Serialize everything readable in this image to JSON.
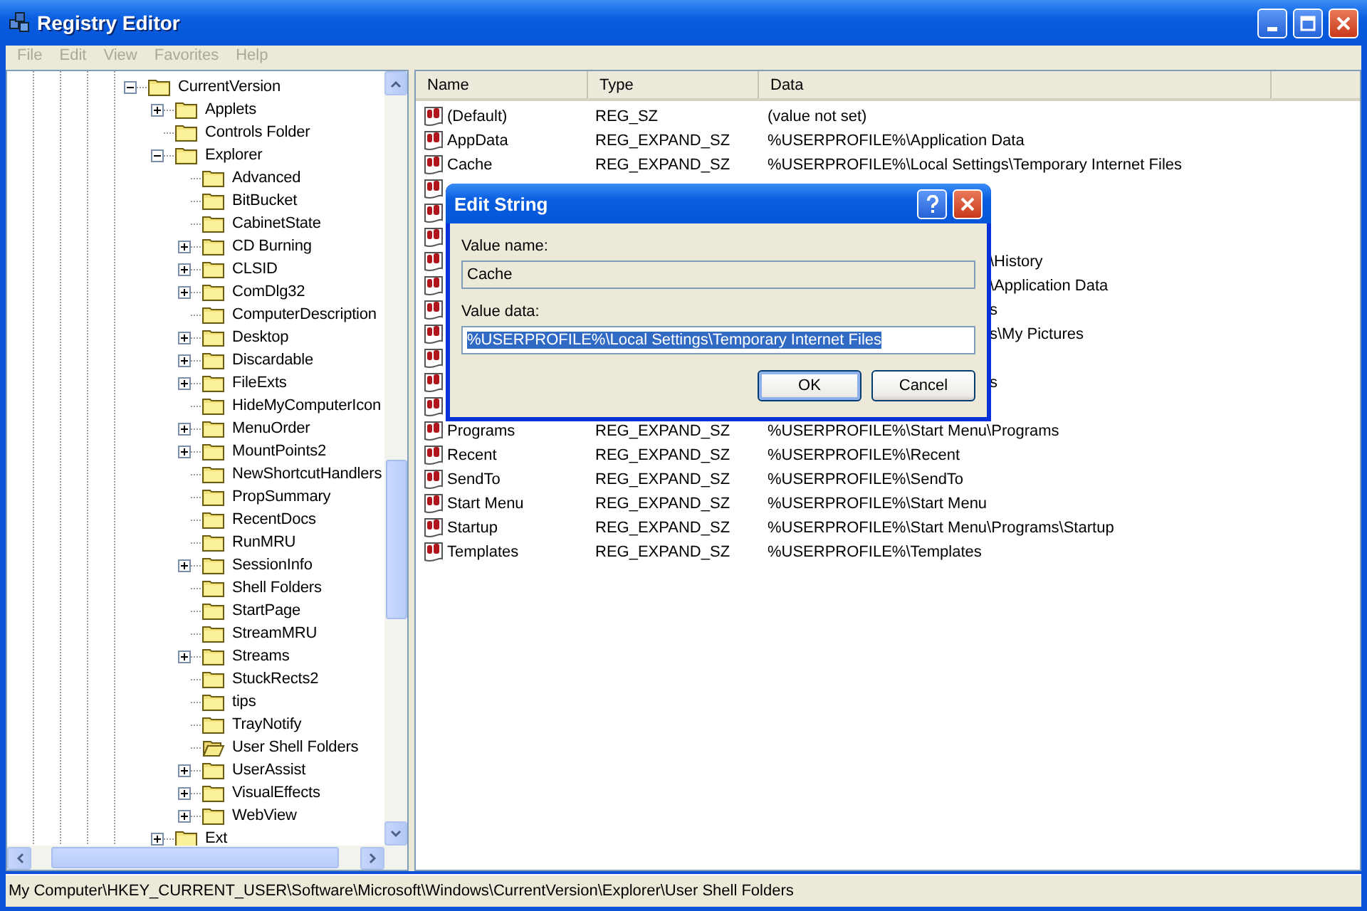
{
  "window": {
    "title": "Registry Editor"
  },
  "menu": [
    {
      "label": "File",
      "disabled": true
    },
    {
      "label": "Edit",
      "disabled": true
    },
    {
      "label": "View",
      "disabled": true
    },
    {
      "label": "Favorites",
      "disabled": true
    },
    {
      "label": "Help",
      "disabled": true
    }
  ],
  "tree": {
    "items": [
      {
        "label": "CurrentVersion",
        "expandable": true,
        "expanded": true,
        "selected": false,
        "children": [
          {
            "label": "Applets",
            "expandable": true,
            "expanded": false,
            "selected": false
          },
          {
            "label": "Controls Folder",
            "expandable": false,
            "expanded": false,
            "selected": false
          },
          {
            "label": "Explorer",
            "expandable": true,
            "expanded": true,
            "selected": false,
            "children": [
              {
                "label": "Advanced",
                "expandable": false,
                "expanded": false,
                "selected": false
              },
              {
                "label": "BitBucket",
                "expandable": false,
                "expanded": false,
                "selected": false
              },
              {
                "label": "CabinetState",
                "expandable": false,
                "expanded": false,
                "selected": false
              },
              {
                "label": "CD Burning",
                "expandable": true,
                "expanded": false,
                "selected": false
              },
              {
                "label": "CLSID",
                "expandable": true,
                "expanded": false,
                "selected": false
              },
              {
                "label": "ComDlg32",
                "expandable": true,
                "expanded": false,
                "selected": false
              },
              {
                "label": "ComputerDescription",
                "expandable": false,
                "expanded": false,
                "selected": false
              },
              {
                "label": "Desktop",
                "expandable": true,
                "expanded": false,
                "selected": false
              },
              {
                "label": "Discardable",
                "expandable": true,
                "expanded": false,
                "selected": false
              },
              {
                "label": "FileExts",
                "expandable": true,
                "expanded": false,
                "selected": false
              },
              {
                "label": "HideMyComputerIcon",
                "expandable": false,
                "expanded": false,
                "selected": false
              },
              {
                "label": "MenuOrder",
                "expandable": true,
                "expanded": false,
                "selected": false
              },
              {
                "label": "MountPoints2",
                "expandable": true,
                "expanded": false,
                "selected": false
              },
              {
                "label": "NewShortcutHandlers",
                "expandable": false,
                "expanded": false,
                "selected": false
              },
              {
                "label": "PropSummary",
                "expandable": false,
                "expanded": false,
                "selected": false
              },
              {
                "label": "RecentDocs",
                "expandable": false,
                "expanded": false,
                "selected": false
              },
              {
                "label": "RunMRU",
                "expandable": false,
                "expanded": false,
                "selected": false
              },
              {
                "label": "SessionInfo",
                "expandable": true,
                "expanded": false,
                "selected": false
              },
              {
                "label": "Shell Folders",
                "expandable": false,
                "expanded": false,
                "selected": false
              },
              {
                "label": "StartPage",
                "expandable": false,
                "expanded": false,
                "selected": false
              },
              {
                "label": "StreamMRU",
                "expandable": false,
                "expanded": false,
                "selected": false
              },
              {
                "label": "Streams",
                "expandable": true,
                "expanded": false,
                "selected": false
              },
              {
                "label": "StuckRects2",
                "expandable": false,
                "expanded": false,
                "selected": false
              },
              {
                "label": "tips",
                "expandable": false,
                "expanded": false,
                "selected": false
              },
              {
                "label": "TrayNotify",
                "expandable": false,
                "expanded": false,
                "selected": false
              },
              {
                "label": "User Shell Folders",
                "expandable": false,
                "expanded": false,
                "selected": true
              },
              {
                "label": "UserAssist",
                "expandable": true,
                "expanded": false,
                "selected": false
              },
              {
                "label": "VisualEffects",
                "expandable": true,
                "expanded": false,
                "selected": false
              },
              {
                "label": "WebView",
                "expandable": true,
                "expanded": false,
                "selected": false
              }
            ]
          },
          {
            "label": "Ext",
            "expandable": true,
            "expanded": false,
            "selected": false
          }
        ]
      }
    ]
  },
  "list": {
    "columns": [
      "Name",
      "Type",
      "Data"
    ],
    "rows": [
      {
        "kind": "value",
        "name": "(Default)",
        "type": "REG_SZ",
        "data": "(value not set)"
      },
      {
        "kind": "value",
        "name": "AppData",
        "type": "REG_EXPAND_SZ",
        "data": "%USERPROFILE%\\Application Data"
      },
      {
        "kind": "value",
        "name": "Cache",
        "type": "REG_EXPAND_SZ",
        "data": "%USERPROFILE%\\Local Settings\\Temporary Internet Files"
      },
      {
        "kind": "covered"
      },
      {
        "kind": "covered"
      },
      {
        "kind": "covered"
      },
      {
        "kind": "covered",
        "data": "\\History"
      },
      {
        "kind": "covered",
        "data": "\\Application Data"
      },
      {
        "kind": "covered",
        "data": "s"
      },
      {
        "kind": "covered",
        "data": "s\\My Pictures"
      },
      {
        "kind": "covered"
      },
      {
        "kind": "covered",
        "data": "s"
      },
      {
        "kind": "covered"
      },
      {
        "kind": "value",
        "name": "Programs",
        "type": "REG_EXPAND_SZ",
        "data": "%USERPROFILE%\\Start Menu\\Programs"
      },
      {
        "kind": "value",
        "name": "Recent",
        "type": "REG_EXPAND_SZ",
        "data": "%USERPROFILE%\\Recent"
      },
      {
        "kind": "value",
        "name": "SendTo",
        "type": "REG_EXPAND_SZ",
        "data": "%USERPROFILE%\\SendTo"
      },
      {
        "kind": "value",
        "name": "Start Menu",
        "type": "REG_EXPAND_SZ",
        "data": "%USERPROFILE%\\Start Menu"
      },
      {
        "kind": "value",
        "name": "Startup",
        "type": "REG_EXPAND_SZ",
        "data": "%USERPROFILE%\\Start Menu\\Programs\\Startup"
      },
      {
        "kind": "value",
        "name": "Templates",
        "type": "REG_EXPAND_SZ",
        "data": "%USERPROFILE%\\Templates"
      }
    ]
  },
  "dialog": {
    "title": "Edit String",
    "name_label": "Value name:",
    "name_value": "Cache",
    "data_label": "Value data:",
    "data_value": "%USERPROFILE%\\Local Settings\\Temporary Internet Files",
    "data_selected": true,
    "buttons": [
      {
        "label": "OK",
        "default": true
      },
      {
        "label": "Cancel",
        "default": false
      }
    ]
  },
  "status_bar": "My Computer\\HKEY_CURRENT_USER\\Software\\Microsoft\\Windows\\CurrentVersion\\Explorer\\User Shell Folders"
}
